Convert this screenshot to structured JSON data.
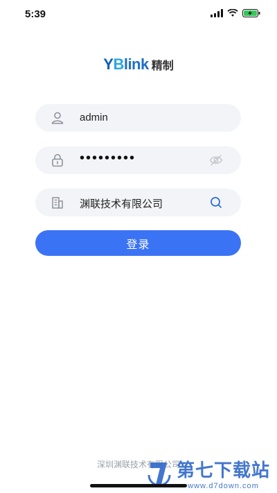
{
  "status": {
    "time": "5:39"
  },
  "logo": {
    "brand_a": "Y",
    "brand_b": "B",
    "brand_rest": "link",
    "suffix": "精制"
  },
  "form": {
    "username": {
      "value": "admin"
    },
    "password": {
      "masked_value": "•••••••••"
    },
    "company": {
      "value": "渊联技术有限公司"
    },
    "login_label": "登录"
  },
  "footer": {
    "text": "深圳渊联技术有限公司"
  },
  "watermark": {
    "title": "第七下载站",
    "url": "www.d7down.com"
  },
  "colors": {
    "accent": "#3b73f5",
    "field_bg": "#f3f4f7",
    "icon_gray": "#8d929a",
    "search_icon": "#2f6fd6"
  }
}
